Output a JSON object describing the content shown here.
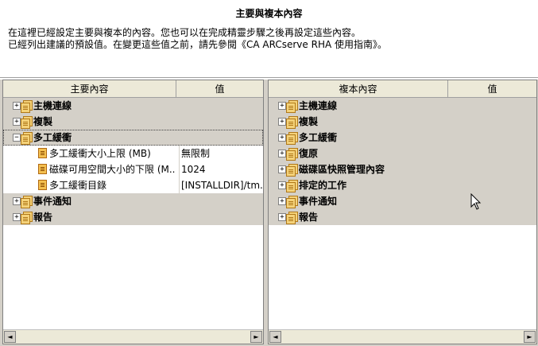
{
  "header": {
    "title": "主要與複本內容",
    "line1": "在這裡已經設定主要與複本的內容。您也可以在完成精靈步驟之後再設定這些內容。",
    "line2": "已經列出建議的預設值。在變更這些值之前，請先參閱《CA ARCserve RHA 使用指南》。"
  },
  "left": {
    "col_property": "主要內容",
    "col_value": "值",
    "groups": [
      {
        "label": "主機連線",
        "expander": "+"
      },
      {
        "label": "複製",
        "expander": "+"
      },
      {
        "label": "多工緩衝",
        "expander": "−"
      },
      {
        "label": "事件通知",
        "expander": "+"
      },
      {
        "label": "報告",
        "expander": "+"
      }
    ],
    "items": [
      {
        "label": "多工緩衝大小上限 (MB)",
        "value": "無限制"
      },
      {
        "label": "磁碟可用空間大小的下限 (M...",
        "value": "1024"
      },
      {
        "label": "多工緩衝目錄",
        "value": "[INSTALLDIR]/tm..."
      }
    ]
  },
  "right": {
    "col_property": "複本內容",
    "col_value": "值",
    "groups": [
      {
        "label": "主機連線",
        "expander": "+"
      },
      {
        "label": "複製",
        "expander": "+"
      },
      {
        "label": "多工緩衝",
        "expander": "+"
      },
      {
        "label": "復原",
        "expander": "+"
      },
      {
        "label": "磁碟區快照管理內容",
        "expander": "+"
      },
      {
        "label": "排定的工作",
        "expander": "+"
      },
      {
        "label": "事件通知",
        "expander": "+"
      },
      {
        "label": "報告",
        "expander": "+"
      }
    ]
  },
  "scroll": {
    "left_arrow": "◄",
    "right_arrow": "►"
  }
}
